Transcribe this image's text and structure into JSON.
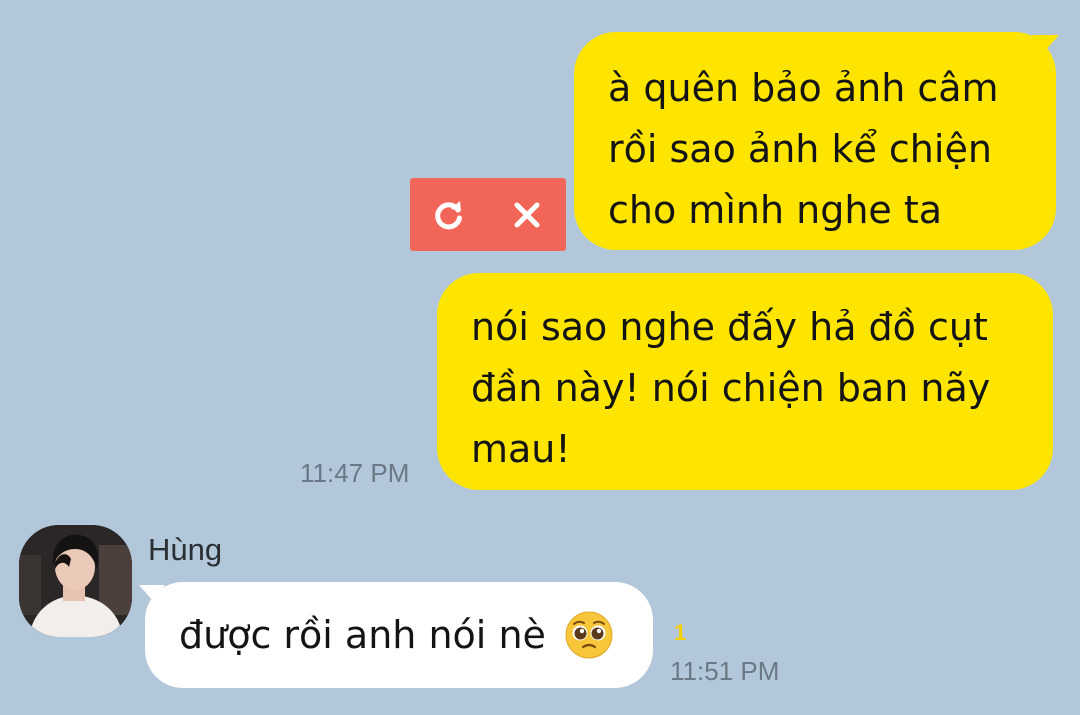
{
  "messages": [
    {
      "id": "m1",
      "direction": "outgoing",
      "status": "failed",
      "lines": [
        "à quên bảo ảnh câm",
        "rồi sao ảnh kể chiện",
        "cho mình nghe ta"
      ]
    },
    {
      "id": "m2",
      "direction": "outgoing",
      "time": "11:47 PM",
      "lines": [
        "nói sao nghe đấy hả đồ cụt",
        "đần này! nói chiện ban nãy",
        "mau!"
      ]
    },
    {
      "id": "m3",
      "direction": "incoming",
      "sender": "Hùng",
      "text": "được rồi anh nói nè",
      "emoji": "pleading-face",
      "unread": "1",
      "time": "11:51 PM"
    }
  ],
  "failed_actions": {
    "retry_icon": "retry-icon",
    "delete_icon": "close-icon"
  },
  "colors": {
    "background": "#b2c7da",
    "outgoing_bubble": "#fee500",
    "incoming_bubble": "#ffffff",
    "failed_control": "#f2665a",
    "timestamp": "#6b7886",
    "unread": "#f5d000"
  }
}
